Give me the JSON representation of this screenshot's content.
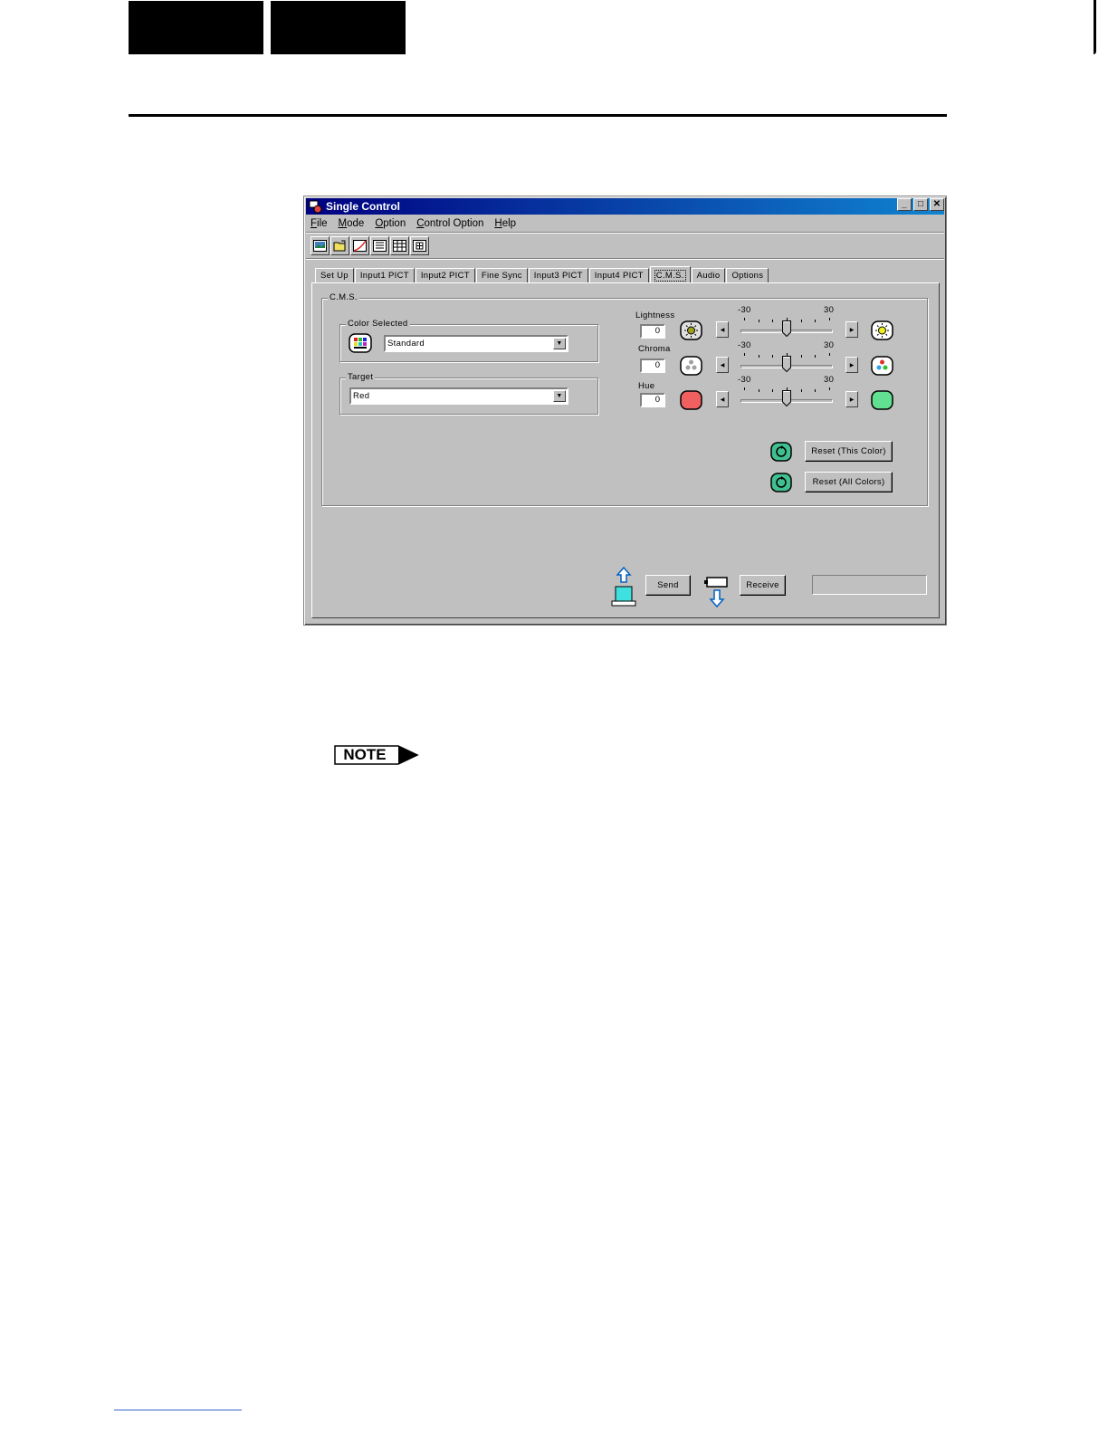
{
  "window": {
    "title": "Single Control",
    "menu": [
      "File",
      "Mode",
      "Option",
      "Control Option",
      "Help"
    ],
    "controls": {
      "minimize": "_",
      "maximize": "□",
      "close": "✕"
    }
  },
  "toolbar": {
    "buttons": [
      "picture-icon",
      "folder-open-icon",
      "gamma-curve-icon",
      "list-view-icon",
      "grid-view-icon",
      "detail-view-icon"
    ]
  },
  "tabs": [
    "Set Up",
    "Input1 PICT",
    "Input2 PICT",
    "Fine Sync",
    "Input3 PICT",
    "Input4 PICT",
    "C.M.S.",
    "Audio",
    "Options"
  ],
  "active_tab": "C.M.S.",
  "cms": {
    "group_label": "C.M.S.",
    "color_selected": {
      "label": "Color Selected",
      "value": "Standard"
    },
    "target": {
      "label": "Target",
      "value": "Red"
    },
    "sliders": [
      {
        "label": "Lightness",
        "value": "0",
        "min": "-30",
        "max": "30",
        "level": 0.5
      },
      {
        "label": "Chroma",
        "value": "0",
        "min": "-30",
        "max": "30",
        "level": 0.5
      },
      {
        "label": "Hue",
        "value": "0",
        "min": "-30",
        "max": "30",
        "level": 0.5
      }
    ],
    "reset_this": "Reset (This Color)",
    "reset_all": "Reset (All Colors)"
  },
  "footer": {
    "send": "Send",
    "receive": "Receive",
    "status": ""
  },
  "note": {
    "label": "NOTE"
  },
  "colors": {
    "hue_start": "#f06060",
    "hue_end": "#60e090",
    "titlebar": "#000080",
    "reset_icon": "#40c090"
  }
}
